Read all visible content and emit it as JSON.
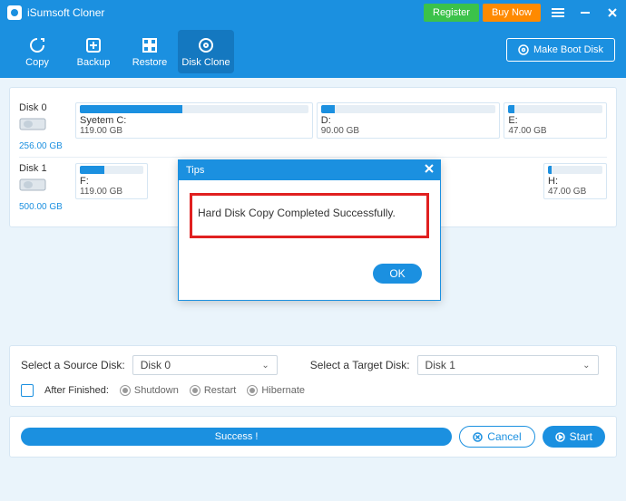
{
  "app": {
    "title": "iSumsoft Cloner"
  },
  "header": {
    "register": "Register",
    "buy": "Buy Now",
    "make_boot": "Make Boot Disk"
  },
  "tabs": {
    "copy": "Copy",
    "backup": "Backup",
    "restore": "Restore",
    "clone": "Disk Clone"
  },
  "disks": {
    "d0": {
      "name": "Disk 0",
      "size": "256.00 GB"
    },
    "d0p0": {
      "name": "Syetem C:",
      "size": "119.00 GB"
    },
    "d0p1": {
      "name": "D:",
      "size": "90.00 GB"
    },
    "d0p2": {
      "name": "E:",
      "size": "47.00 GB"
    },
    "d1": {
      "name": "Disk 1",
      "size": "500.00 GB"
    },
    "d1p0": {
      "name": "F:",
      "size": "119.00 GB"
    },
    "d1p1": {
      "name": "H:",
      "size": "47.00 GB"
    }
  },
  "select": {
    "source_label": "Select a Source Disk:",
    "source_value": "Disk 0",
    "target_label": "Select a Target Disk:",
    "target_value": "Disk 1",
    "after_label": "After Finished:",
    "shutdown": "Shutdown",
    "restart": "Restart",
    "hibernate": "Hibernate"
  },
  "bottom": {
    "progress": "Success !",
    "cancel": "Cancel",
    "start": "Start"
  },
  "modal": {
    "title": "Tips",
    "message": "Hard Disk Copy Completed Successfully.",
    "ok": "OK"
  }
}
